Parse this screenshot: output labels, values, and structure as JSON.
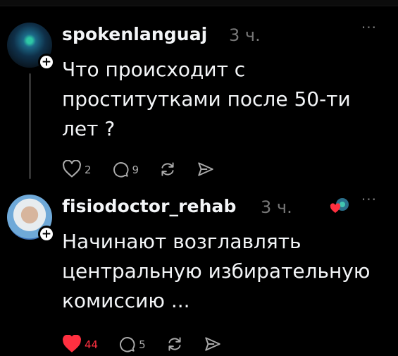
{
  "posts": [
    {
      "username": "spokenlanguaj",
      "time": "3 ч.",
      "more_label": "···",
      "text": "Что происходит с\nпроститутками после 50-ти\nлет ?",
      "actions": {
        "likes": "2",
        "replies": "9"
      },
      "liked": false
    },
    {
      "username": "fisiodoctor_rehab",
      "time": "3 ч.",
      "more_label": "···",
      "text": "Начинают возглавлять\nцентральную избирательную\nкомиссию ...",
      "actions": {
        "likes": "44",
        "replies": "5"
      },
      "liked": true
    }
  ],
  "colors": {
    "background": "#000000",
    "text": "#f3f5f7",
    "muted": "#777777",
    "like": "#ff3040"
  },
  "icons": [
    "plus-icon",
    "heart-icon",
    "reply-icon",
    "repost-icon",
    "share-icon",
    "more-icon"
  ]
}
